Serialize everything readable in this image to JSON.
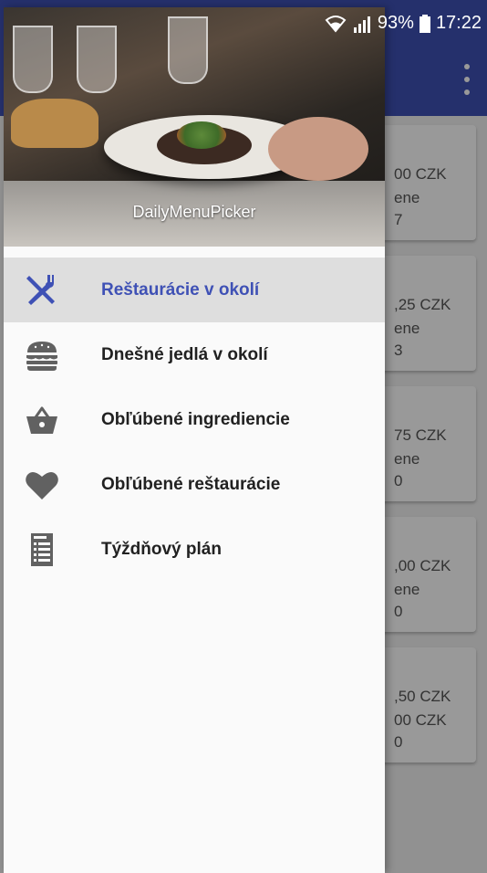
{
  "status_bar": {
    "battery": "93%",
    "time": "17:22"
  },
  "app": {
    "cards": [
      {
        "line1": "00 CZK",
        "line2": "ene",
        "line3": "7"
      },
      {
        "line1": ",25 CZK",
        "line2": "ene",
        "line3": "3"
      },
      {
        "line1": "75 CZK",
        "line2": "ene",
        "line3": "0"
      },
      {
        "line1": ",00 CZK",
        "line2": "ene",
        "line3": "0"
      },
      {
        "line1": ",50 CZK",
        "line2": "00 CZK",
        "line3": "0"
      }
    ]
  },
  "drawer": {
    "header_title": "DailyMenuPicker",
    "items": [
      {
        "label": "Reštaurácie v okolí",
        "icon": "fork-knife-icon",
        "active": true
      },
      {
        "label": "Dnešné jedlá v okolí",
        "icon": "burger-icon",
        "active": false
      },
      {
        "label": "Obľúbené ingrediencie",
        "icon": "basket-icon",
        "active": false
      },
      {
        "label": "Obľúbené reštaurácie",
        "icon": "heart-icon",
        "active": false
      },
      {
        "label": "Týždňový plán",
        "icon": "menu-list-icon",
        "active": false
      }
    ]
  },
  "colors": {
    "primary": "#3f51b5",
    "active_bg": "#dedede",
    "icon_gray": "#616161"
  }
}
